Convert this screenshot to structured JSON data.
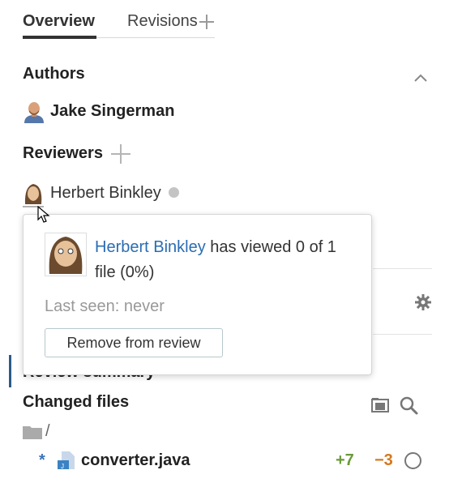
{
  "tabs": {
    "overview": "Overview",
    "revisions": "Revisions"
  },
  "authors": {
    "title": "Authors",
    "items": [
      {
        "name": "Jake Singerman"
      }
    ]
  },
  "reviewers": {
    "title": "Reviewers",
    "items": [
      {
        "name": "Herbert Binkley",
        "status": "not reviewed"
      }
    ]
  },
  "popup": {
    "reviewer_name": "Herbert Binkley",
    "viewed_text": " has viewed 0 of 1 file (0%)",
    "last_seen": "Last seen: never",
    "remove_button": "Remove from review"
  },
  "review_summary": {
    "title": "Review summary"
  },
  "changed_files": {
    "title": "Changed files",
    "root": "/",
    "files": [
      {
        "marker": "*",
        "name": "converter.java",
        "additions": "+7",
        "deletions": "−3"
      }
    ]
  },
  "colors": {
    "link": "#2a6db3",
    "additions": "#6a9a3a",
    "deletions": "#d4781e",
    "accent": "#2b5b8a"
  },
  "icons": [
    "plus-icon",
    "chevron-up-icon",
    "gear-icon",
    "folder-toggle-icon",
    "search-icon",
    "folder-icon",
    "java-file-icon",
    "circle-icon",
    "cursor-icon"
  ]
}
